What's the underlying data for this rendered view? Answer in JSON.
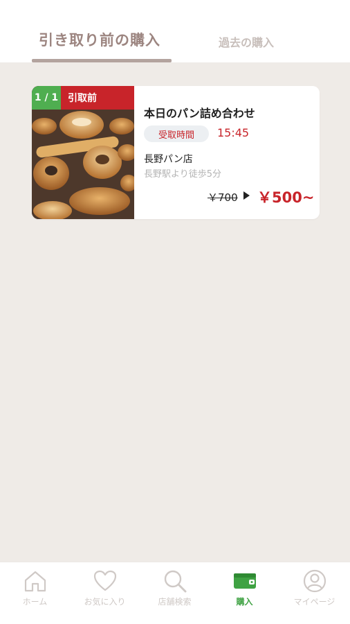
{
  "tabs": {
    "active": "引き取り前の購入",
    "inactive": "過去の購入"
  },
  "order_card": {
    "count_badge": "1 / 1",
    "status_badge": "引取前",
    "title": "本日のパン詰め合わせ",
    "pickup_label": "受取時間",
    "pickup_time": "15:45",
    "shop_name": "長野パン店",
    "shop_access": "長野駅より徒歩5分",
    "price_original": "￥700",
    "price_discount": "￥500~"
  },
  "bottom_nav": {
    "items": [
      {
        "label": "ホーム",
        "icon": "home-icon"
      },
      {
        "label": "お気に入り",
        "icon": "heart-icon"
      },
      {
        "label": "店舗検索",
        "icon": "search-icon"
      },
      {
        "label": "購入",
        "icon": "wallet-icon"
      },
      {
        "label": "マイページ",
        "icon": "user-icon"
      }
    ],
    "active_index": 3
  },
  "colors": {
    "accent_red": "#c8242a",
    "accent_green": "#3fa243",
    "tab_active": "#9c8580",
    "background": "#efebe7"
  }
}
